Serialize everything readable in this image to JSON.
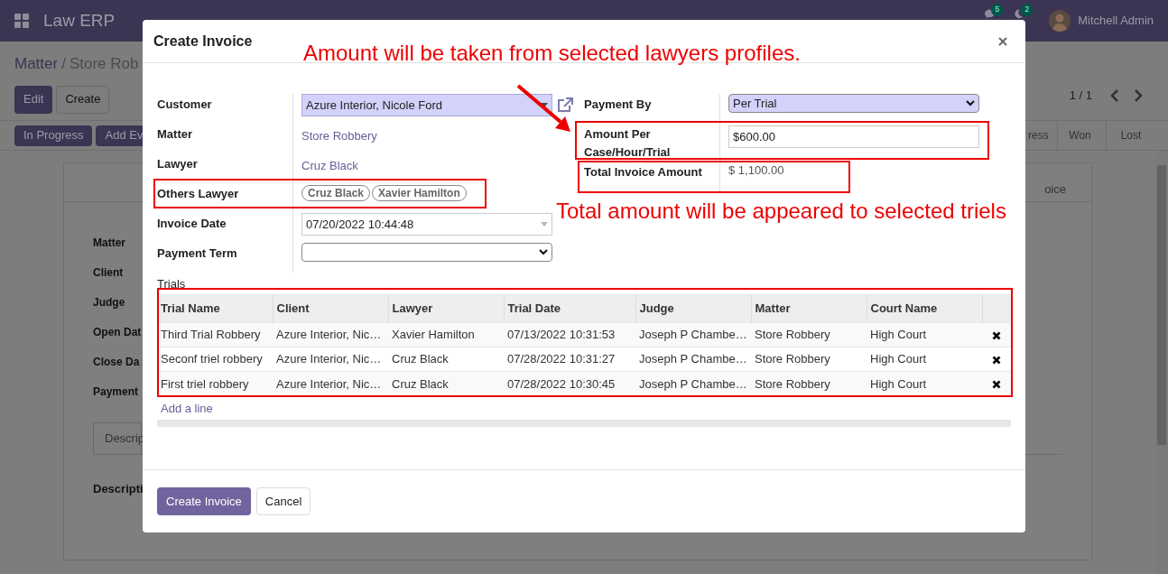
{
  "navbar": {
    "app_title": "Law ERP",
    "notifications": [
      {
        "kind": "chat",
        "count": "5"
      },
      {
        "kind": "activity",
        "count": "2"
      }
    ],
    "user": "Mitchell Admin"
  },
  "background": {
    "breadcrumb": {
      "parent": "Matter",
      "separator": "/",
      "current": "Store Rob"
    },
    "buttons": [
      {
        "label": "Edit",
        "kind": "primary"
      },
      {
        "label": "Create",
        "kind": "secondary"
      }
    ],
    "pager": "1 / 1",
    "actions": [
      "In Progress",
      "Add Ev"
    ],
    "stages": [
      "ress",
      "Won",
      "Lost"
    ],
    "sheet_tab": "oice",
    "fields": [
      "Matter",
      "Client",
      "Judge",
      "Open Dat",
      "Close Da",
      "Payment"
    ],
    "notebook_tab": "Descrip",
    "description_label": "Descripti"
  },
  "dialog": {
    "title": "Create Invoice",
    "left_fields": [
      {
        "label": "Customer",
        "kind": "many2one",
        "value": "Azure Interior, Nicole Ford"
      },
      {
        "label": "Matter",
        "kind": "link",
        "value": "Store Robbery"
      },
      {
        "label": "Lawyer",
        "kind": "link",
        "value": "Cruz Black"
      },
      {
        "label": "Others Lawyer",
        "kind": "tags",
        "tags": [
          "Cruz Black",
          "Xavier Hamilton"
        ]
      },
      {
        "label": "Invoice Date",
        "kind": "date",
        "value": "07/20/2022 10:44:48"
      },
      {
        "label": "Payment Term",
        "kind": "select"
      }
    ],
    "right_fields": [
      {
        "label": "Payment By",
        "kind": "select",
        "value": "Per Trial"
      },
      {
        "label": "Amount Per Case/Hour/Trial",
        "kind": "input",
        "value": "$600.00"
      },
      {
        "label": "Total Invoice Amount",
        "kind": "text",
        "value": "$ 1,100.00"
      }
    ],
    "trials": {
      "label": "Trials",
      "columns": [
        "Trial Name",
        "Client",
        "Lawyer",
        "Trial Date",
        "Judge",
        "Matter",
        "Court Name"
      ],
      "rows": [
        [
          "Third Trial Robbery",
          "Azure Interior, Nic…",
          "Xavier Hamilton",
          "07/13/2022 10:31:53",
          "Joseph P Chambe…",
          "Store Robbery",
          "High Court"
        ],
        [
          "Seconf triel robbery",
          "Azure Interior, Nic…",
          "Cruz Black",
          "07/28/2022 10:31:27",
          "Joseph P Chambe…",
          "Store Robbery",
          "High Court"
        ],
        [
          "First triel robbery",
          "Azure Interior, Nic…",
          "Cruz Black",
          "07/28/2022 10:30:45",
          "Joseph P Chambe…",
          "Store Robbery",
          "High Court"
        ]
      ],
      "add_line": "Add a line"
    },
    "buttons": [
      {
        "label": "Create Invoice",
        "kind": "primary"
      },
      {
        "label": "Cancel",
        "kind": "secondary"
      }
    ]
  },
  "annotations": [
    "Amount will be taken from selected lawyers profiles.",
    "Total amount will be appeared to selected triels"
  ]
}
